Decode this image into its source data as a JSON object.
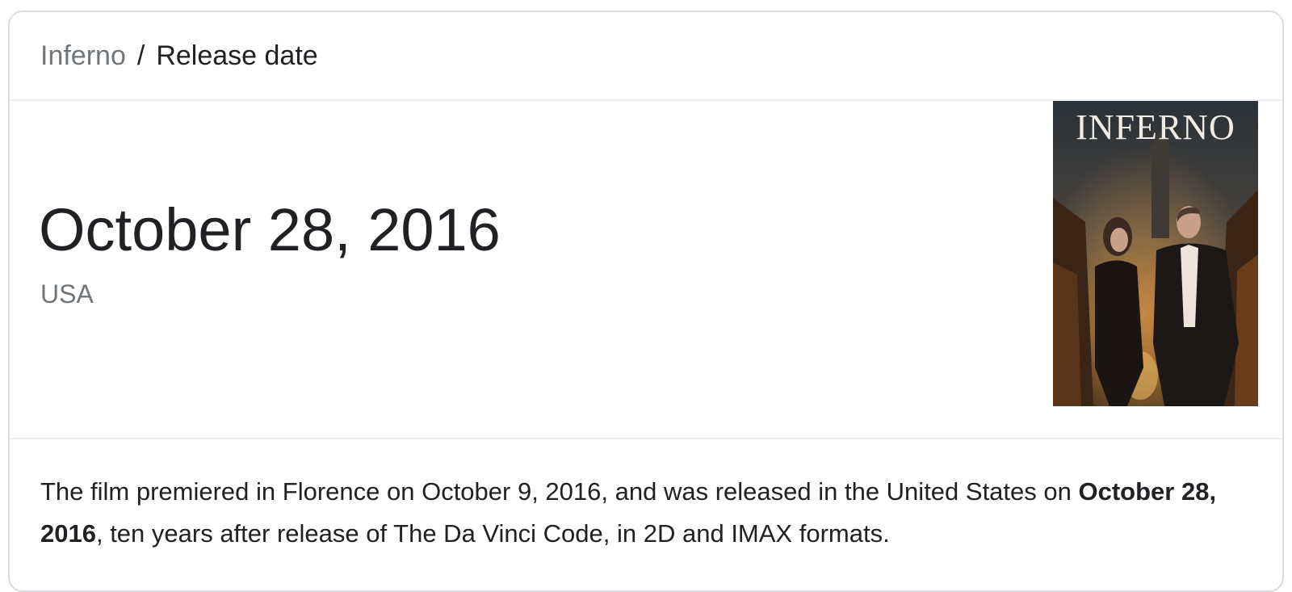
{
  "breadcrumb": {
    "parent": "Inferno",
    "separator": "/",
    "current": "Release date"
  },
  "answer": {
    "date": "October 28, 2016",
    "region": "USA"
  },
  "poster": {
    "title": "INFERNO"
  },
  "description": {
    "part1": "The film premiered in Florence on October 9, 2016, and was released in the United States on ",
    "bold": "October 28, 2016",
    "part2": ", ten years after release of The Da Vinci Code, in 2D and IMAX formats."
  },
  "colors": {
    "border": "#dadce0",
    "divider": "#e8eaed",
    "muted_text": "#70757a",
    "primary_text": "#202124"
  }
}
